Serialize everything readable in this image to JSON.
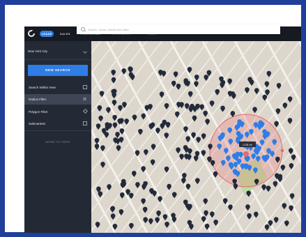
{
  "nav": {
    "tabs": [
      "LEASE",
      "SALES",
      "PROPERTIES"
    ],
    "companies": "My Companies",
    "support": "Support"
  },
  "sidebar": {
    "city": "New York City",
    "new_search_label": "NEW SEARCH",
    "items": [
      {
        "label": "Search Within View",
        "icon": "dashed-square-icon"
      },
      {
        "label": "Radius Filter",
        "icon": "close-x-icon"
      },
      {
        "label": "Polygon Filter",
        "icon": "polygon-icon"
      },
      {
        "label": "Submarkets",
        "icon": "grid-icon"
      }
    ],
    "more_filters": "MORE FILTERS"
  },
  "search": {
    "placeholder": "Search...Areas, streets and cities"
  },
  "map": {
    "radius_label": "0.25 mi",
    "marker_color_default": "#232a3a",
    "marker_color_selected": "#2f7de6",
    "radius_color": "#e36a6a",
    "park_color": "#b9dea0"
  }
}
